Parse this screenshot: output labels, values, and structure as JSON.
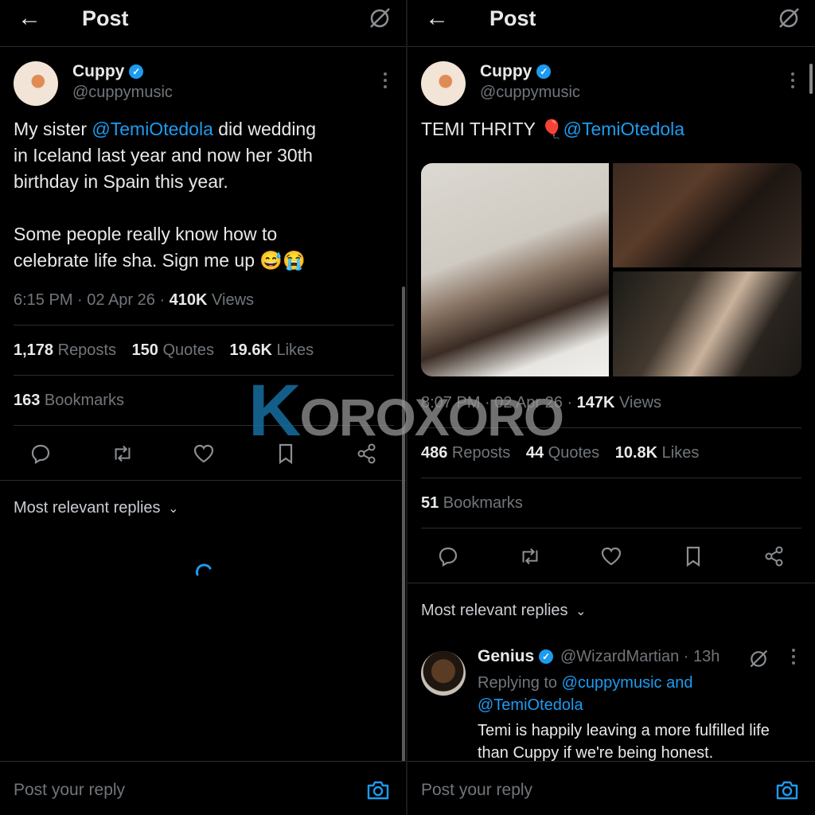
{
  "left": {
    "header": {
      "title": "Post"
    },
    "post": {
      "author_name": "Cuppy",
      "author_handle": "@cuppymusic",
      "text_l1_a": "My sister ",
      "text_l1_mention": "@TemiOtedola",
      "text_l1_b": " did wedding",
      "text_l2": "in Iceland last year and now her 30th",
      "text_l3": "birthday in Spain this year.",
      "text_l4": "Some people really know how to",
      "text_l5": "celebrate life sha. Sign me up 😅😭",
      "time": "6:15 PM · 02 Apr 26 · ",
      "views_count": "410K",
      "views_label": " Views",
      "reposts_count": "1,178",
      "reposts_label": " Reposts",
      "quotes_count": "150",
      "quotes_label": " Quotes",
      "likes_count": "19.6K",
      "likes_label": " Likes",
      "bookmarks_count": "163",
      "bookmarks_label": " Bookmarks"
    },
    "replies_sort": "Most relevant replies",
    "reply_placeholder": "Post your reply"
  },
  "right": {
    "header": {
      "title": "Post"
    },
    "post": {
      "author_name": "Cuppy",
      "author_handle": "@cuppymusic",
      "text_a": "TEMI THRITY ",
      "text_emoji": "🎈",
      "text_mention": "@TemiOtedola",
      "time": "8:07 PM · 02 Apr 26 · ",
      "views_count": "147K",
      "views_label": " Views",
      "reposts_count": "486",
      "reposts_label": " Reposts",
      "quotes_count": "44",
      "quotes_label": " Quotes",
      "likes_count": "10.8K",
      "likes_label": " Likes",
      "bookmarks_count": "51",
      "bookmarks_label": " Bookmarks"
    },
    "replies_sort": "Most relevant replies",
    "reply": {
      "name": "Genius",
      "handle": "@WizardMartian · 13h",
      "replying_prefix": "Replying to ",
      "replying_mention1": "@cuppymusic",
      "replying_and": " and",
      "replying_mention2": "@TemiOtedola",
      "text": "Temi is happily leaving a more fulfilled life than Cuppy if we're being honest."
    },
    "reply_placeholder": "Post your reply"
  },
  "watermark": {
    "k": "K",
    "rest": "OROXORO"
  },
  "colors": {
    "accent": "#1d9bf0",
    "muted": "#71767b",
    "text": "#e7e9ea",
    "background": "#000000"
  },
  "icons": [
    "back-arrow-icon",
    "grok-icon",
    "more-icon",
    "verified-badge-icon",
    "reply-icon",
    "repost-icon",
    "like-icon",
    "bookmark-icon",
    "share-icon",
    "chevron-down-icon",
    "camera-icon",
    "loading-spinner-icon"
  ]
}
